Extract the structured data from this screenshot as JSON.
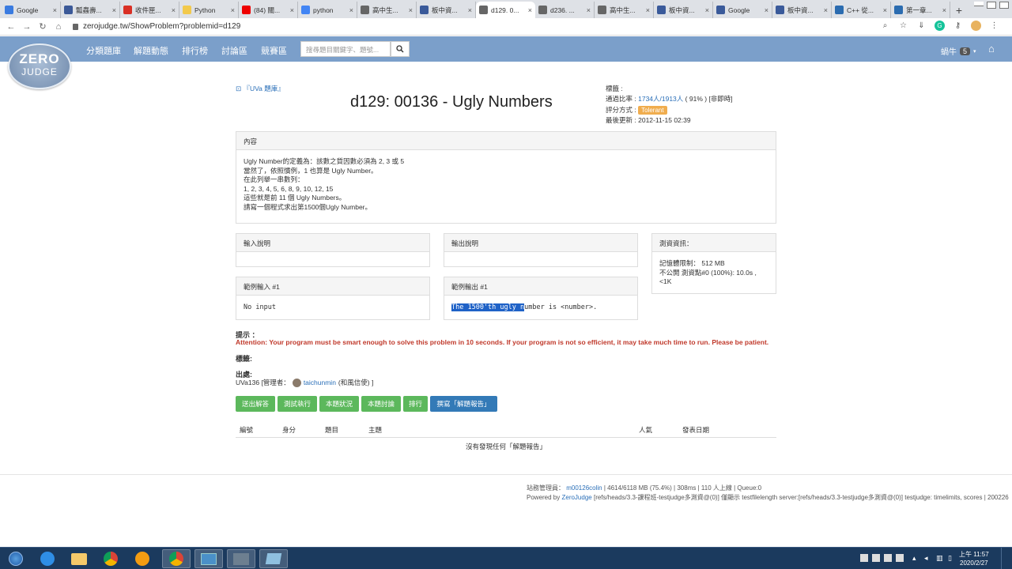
{
  "browser": {
    "tabs": [
      {
        "title": "Google",
        "icon": "calendar-icon",
        "color": "#3a7be0",
        "active": false
      },
      {
        "title": "瓢蟲壽...",
        "icon": "facebook-icon",
        "color": "#3b5998",
        "active": false
      },
      {
        "title": "收件匣...",
        "icon": "gmail-icon",
        "color": "#d93025",
        "active": false
      },
      {
        "title": "Python",
        "icon": "python-icon",
        "color": "#f2c94c",
        "active": false
      },
      {
        "title": "(84) 關...",
        "icon": "youtube-icon",
        "color": "#e00",
        "active": false
      },
      {
        "title": "python",
        "icon": "google-icon",
        "color": "#4285f4",
        "active": false
      },
      {
        "title": "高中生...",
        "icon": "globe-icon",
        "color": "#666",
        "active": false
      },
      {
        "title": "板中資...",
        "icon": "site-icon",
        "color": "#3a5a9a",
        "active": false
      },
      {
        "title": "d129. 0...",
        "icon": "globe-icon",
        "color": "#666",
        "active": true
      },
      {
        "title": "d236. ...",
        "icon": "globe-icon",
        "color": "#666",
        "active": false
      },
      {
        "title": "高中生...",
        "icon": "globe-icon",
        "color": "#666",
        "active": false
      },
      {
        "title": "板中資...",
        "icon": "site-icon",
        "color": "#3a5a9a",
        "active": false
      },
      {
        "title": "Google",
        "icon": "site-icon",
        "color": "#3a5a9a",
        "active": false
      },
      {
        "title": "板中資...",
        "icon": "site-icon",
        "color": "#3a5a9a",
        "active": false
      },
      {
        "title": "C++ 從...",
        "icon": "doc-icon",
        "color": "#2b6cb0",
        "active": false
      },
      {
        "title": "第一章...",
        "icon": "doc-icon",
        "color": "#2b6cb0",
        "active": false
      }
    ],
    "url": "zerojudge.tw/ShowProblem?problemid=d129"
  },
  "site": {
    "logo_top": "ZERO",
    "logo_bottom": "JUDGE",
    "nav": [
      "分類題庫",
      "解題動態",
      "排行榜",
      "討論區",
      "競賽區"
    ],
    "search_placeholder": "搜尋題目關鍵字、題號...",
    "username": "蝸牛",
    "user_badge": "5"
  },
  "problem": {
    "category_link": "『UVa 題庫』",
    "title": "d129: 00136 - Ugly Numbers",
    "meta": {
      "tags_label": "標籤 :",
      "pass_label": "通過比率 :",
      "pass_link": "1734人/1913人",
      "pass_rest": "( 91% ) [非即時]",
      "judge_label": "評分方式 :",
      "judge_value": "Tolerant",
      "updated_label": "最後更新 :",
      "updated_value": "2012-11-15 02:39"
    },
    "content_header": "內容",
    "content_lines": [
      "Ugly Number的定義為：該數之質因數必須為 2, 3 或 5",
      "當然了，依照慣例，1 也算是 Ugly Number。",
      "在此列舉一串數列：",
      "1, 2, 3, 4, 5, 6, 8, 9, 10, 12, 15",
      "這些就是前 11 個 Ugly Numbers。",
      "請寫一個程式求出第1500個Ugly Number。"
    ],
    "input_header": "輸入說明",
    "output_header": "輸出說明",
    "test_header": "測資資訊：",
    "test_lines": [
      "記憶體限制： 512 MB",
      "不公開 測資點#0 (100%): 10.0s , <1K"
    ],
    "sample_in_header": "範例輸入 #1",
    "sample_in": "No input",
    "sample_out_header": "範例輸出 #1",
    "sample_out_hl": "The 1500'th ugly n",
    "sample_out_rest": "umber is <number>.",
    "hint_label": "提示 ：",
    "hint_text": "Attention: Your program must be smart enough to solve this problem in 10 seconds. If your program is not so efficient, it may take much time to run. Please be patient.",
    "tags_section": "標籤:",
    "source_label": "出處:",
    "source_text": "UVa136 [管理者：",
    "source_user": "taichunmin",
    "source_rest": "(和風信使) ]"
  },
  "buttons": [
    "送出解答",
    "測試執行",
    "本題狀況",
    "本題討論",
    "排行",
    "撰寫「解題報告」"
  ],
  "solutions": {
    "headers": [
      "編號",
      "身分",
      "題目",
      "主題",
      "人氣",
      "發表日期"
    ],
    "empty": "沒有發現任何「解題報告」"
  },
  "footer": {
    "line1_label": "站務管理員：",
    "line1_link": "m00126colin",
    "line1_rest": "| 4614/6118 MB (75.4%) | 308ms | 110 人上線 | Queue:0",
    "line2_label": "Powered by",
    "line2_link": "ZeroJudge",
    "line2_rest": "[refs/heads/3.3-課程班-testjudge多測資@(0)] 僅顯示 testfilelength server:[refs/heads/3.3-testjudge多測資@(0)] testjudge: timelimits, scores | 200226 |"
  },
  "taskbar": {
    "clock_time": "上午 11:57",
    "clock_date": "2020/2/27"
  }
}
